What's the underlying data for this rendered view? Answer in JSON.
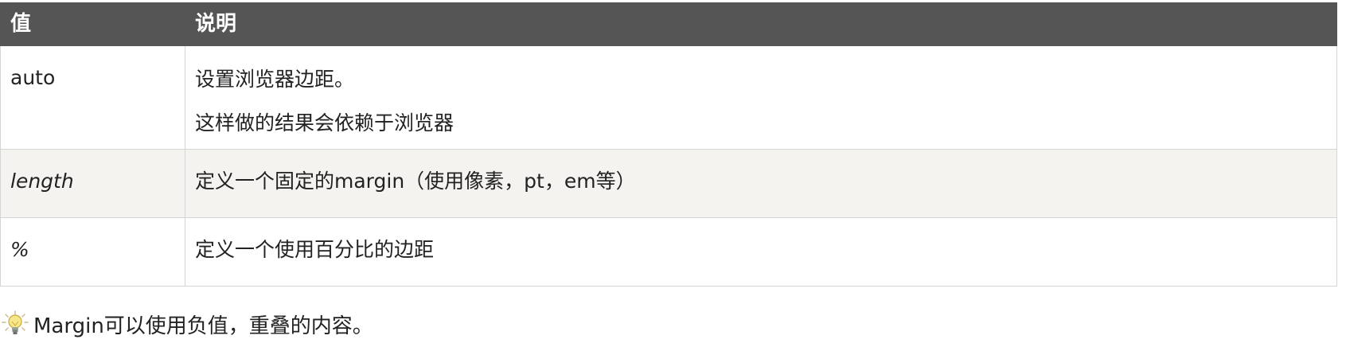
{
  "table": {
    "headers": [
      "值",
      "说明"
    ],
    "rows": [
      {
        "value": "auto",
        "desc": [
          "设置浏览器边距。",
          "这样做的结果会依赖于浏览器"
        ]
      },
      {
        "value": "length",
        "desc": [
          "定义一个固定的margin（使用像素，pt，em等）"
        ]
      },
      {
        "value": "%",
        "desc": [
          "定义一个使用百分比的边距"
        ]
      }
    ]
  },
  "tip": {
    "icon": "lightbulb-icon",
    "text": "Margin可以使用负值，重叠的内容。"
  },
  "colors": {
    "header_bg": "#555555",
    "header_text": "#ffffff",
    "alt_row_bg": "#f4f3f0",
    "border": "#d4d4d4"
  }
}
